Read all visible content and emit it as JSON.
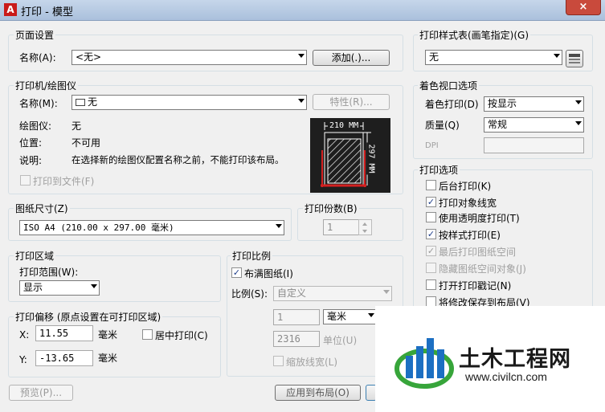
{
  "window": {
    "title": "打印 - 模型",
    "app_icon": "A",
    "close": "×"
  },
  "page_setup": {
    "group": "页面设置",
    "name_label": "名称(A):",
    "name_value": "<无>",
    "add_button": "添加(.)..."
  },
  "printer": {
    "group": "打印机/绘图仪",
    "name_label": "名称(M):",
    "name_value": "无",
    "properties_button": "特性(R)...",
    "plotter_label": "绘图仪:",
    "plotter_value": "无",
    "location_label": "位置:",
    "location_value": "不可用",
    "desc_label": "说明:",
    "desc_value": "在选择新的绘图仪配置名称之前，不能打印该布局。",
    "print_to_file": "打印到文件(F)",
    "preview_width": "210 MM",
    "preview_height": "297 MM"
  },
  "paper_size": {
    "group": "图纸尺寸(Z)",
    "value": "ISO A4 (210.00 x 297.00 毫米)"
  },
  "copies": {
    "group": "打印份数(B)",
    "value": "1"
  },
  "plot_area": {
    "group": "打印区域",
    "range_label": "打印范围(W):",
    "range_value": "显示"
  },
  "plot_offset": {
    "group": "打印偏移 (原点设置在可打印区域)",
    "x_label": "X:",
    "x_value": "11.55",
    "x_unit": "毫米",
    "y_label": "Y:",
    "y_value": "-13.65",
    "y_unit": "毫米",
    "center": "居中打印(C)"
  },
  "plot_scale": {
    "group": "打印比例",
    "fit": "布满图纸(I)",
    "scale_label": "比例(S):",
    "scale_value": "自定义",
    "value1": "1",
    "unit1": "毫米",
    "value2": "2316",
    "unit2": "单位(U)",
    "scale_lineweights": "缩放线宽(L)"
  },
  "plot_style_table": {
    "group": "打印样式表(画笔指定)(G)",
    "value": "无"
  },
  "shaded_viewport": {
    "group": "着色视口选项",
    "shade_label": "着色打印(D)",
    "shade_value": "按显示",
    "quality_label": "质量(Q)",
    "quality_value": "常规",
    "dpi_label": "DPI"
  },
  "plot_options": {
    "group": "打印选项",
    "items": [
      {
        "label": "后台打印(K)",
        "checked": ""
      },
      {
        "label": "打印对象线宽",
        "checked": "✓"
      },
      {
        "label": "使用透明度打印(T)",
        "checked": ""
      },
      {
        "label": "按样式打印(E)",
        "checked": "✓"
      },
      {
        "label": "最后打印图纸空间",
        "checked": "✓"
      },
      {
        "label": "隐藏图纸空间对象(J)",
        "checked": ""
      },
      {
        "label": "打开打印戳记(N)",
        "checked": ""
      },
      {
        "label": "将修改保存到布局(V)",
        "checked": ""
      }
    ]
  },
  "bottom": {
    "preview_button": "预览(P)...",
    "apply_button": "应用到布局(O)"
  },
  "watermark": {
    "brand": "土木工程网",
    "url": "www.civilcn.com"
  },
  "colors": {
    "accent_red": "#d42020",
    "logo_blue": "#1c6fc2",
    "logo_green": "#37a53a"
  }
}
